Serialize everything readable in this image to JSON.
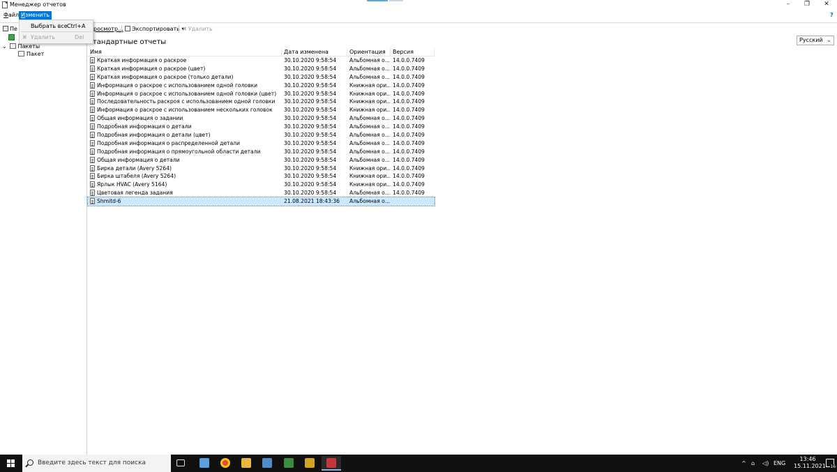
{
  "window": {
    "title": "Менеджер отчетов",
    "controls": {
      "minimize": "–",
      "restore": "❐",
      "close": "✕"
    },
    "help_icon": "?"
  },
  "menubar": {
    "file": {
      "first": "Ф",
      "rest": "айл"
    },
    "edit": {
      "first": "И",
      "rest": "зменить"
    }
  },
  "edit_menu": {
    "items": [
      {
        "label": "Выбрать все",
        "shortcut": "Ctrl+A",
        "enabled": true
      },
      {
        "label": "Удалить",
        "shortcut": "Del",
        "enabled": false
      }
    ]
  },
  "toolbar": {
    "print_label": "Пе",
    "preview_label": "росмотр...",
    "export_label": "Экспортировать",
    "delete_label": "Удалить"
  },
  "tree": {
    "root_label": "Пакеты",
    "child_label": "Пакет"
  },
  "main": {
    "section_title": "Стандартные отчеты",
    "language": "Русский"
  },
  "grid": {
    "columns": [
      "Имя",
      "Дата изменена",
      "Ориентация",
      "Версия"
    ],
    "rows": [
      {
        "name": "Краткая информация о раскрое",
        "date": "30.10.2020 9:58:54",
        "orientation": "Альбомная о...",
        "version": "14.0.0.7409"
      },
      {
        "name": "Краткая информация о раскрое (цвет)",
        "date": "30.10.2020 9:58:54",
        "orientation": "Альбомная о...",
        "version": "14.0.0.7409"
      },
      {
        "name": "Краткая информация о раскрое (только детали)",
        "date": "30.10.2020 9:58:54",
        "orientation": "Альбомная о...",
        "version": "14.0.0.7409"
      },
      {
        "name": "Информация о раскрое с использованием одной головки",
        "date": "30.10.2020 9:58:54",
        "orientation": "Книжная ори...",
        "version": "14.0.0.7409"
      },
      {
        "name": "Информация о раскрое с использованием одной головки (цвет)",
        "date": "30.10.2020 9:58:54",
        "orientation": "Книжная ори...",
        "version": "14.0.0.7409"
      },
      {
        "name": "Последовательность раскроя с использованием одной головки",
        "date": "30.10.2020 9:58:54",
        "orientation": "Книжная ори...",
        "version": "14.0.0.7409"
      },
      {
        "name": "Информация о раскрое с использованием нескольких головок",
        "date": "30.10.2020 9:58:54",
        "orientation": "Книжная ори...",
        "version": "14.0.0.7409"
      },
      {
        "name": "Общая информация о задании",
        "date": "30.10.2020 9:58:54",
        "orientation": "Альбомная о...",
        "version": "14.0.0.7409"
      },
      {
        "name": "Подробная информация о детали",
        "date": "30.10.2020 9:58:54",
        "orientation": "Альбомная о...",
        "version": "14.0.0.7409"
      },
      {
        "name": "Подробная информация о детали (цвет)",
        "date": "30.10.2020 9:58:54",
        "orientation": "Альбомная о...",
        "version": "14.0.0.7409"
      },
      {
        "name": "Подробная информация о распределенной детали",
        "date": "30.10.2020 9:58:54",
        "orientation": "Альбомная о...",
        "version": "14.0.0.7409"
      },
      {
        "name": "Подробная информация о прямоугольной области детали",
        "date": "30.10.2020 9:58:54",
        "orientation": "Альбомная о...",
        "version": "14.0.0.7409"
      },
      {
        "name": "Общая информация о детали",
        "date": "30.10.2020 9:58:54",
        "orientation": "Альбомная о...",
        "version": "14.0.0.7409"
      },
      {
        "name": "Бирка детали (Avery 5264)",
        "date": "30.10.2020 9:58:54",
        "orientation": "Книжная ори...",
        "version": "14.0.0.7409"
      },
      {
        "name": "Бирка штабеля (Avery 5264)",
        "date": "30.10.2020 9:58:54",
        "orientation": "Книжная ори...",
        "version": "14.0.0.7409"
      },
      {
        "name": "Ярлык HVAC (Avery 5164)",
        "date": "30.10.2020 9:58:54",
        "orientation": "Книжная ори...",
        "version": "14.0.0.7409"
      },
      {
        "name": "Цветовая легенда задания",
        "date": "30.10.2020 9:58:54",
        "orientation": "Альбомная о...",
        "version": "14.0.0.7409"
      },
      {
        "name": "Shmitd-6",
        "date": "21.08.2021 18:43:36",
        "orientation": "Альбомная о...",
        "version": "",
        "selected": true
      }
    ]
  },
  "taskbar": {
    "search_placeholder": "Введите здесь текст для поиска",
    "tray_caret": "^",
    "language": "ENG",
    "time": "13:46",
    "date": "15.11.2021",
    "notification_count": "16",
    "accent": "#7eb4ea"
  }
}
